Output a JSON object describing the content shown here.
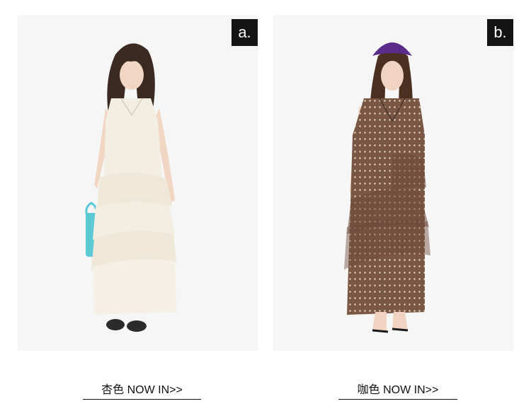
{
  "products": [
    {
      "badge": "a.",
      "link_text": "杏色 NOW IN>>",
      "image_alt": "apricot",
      "dress_color": "#f3eee2",
      "accent_color": "#5cc9d4"
    },
    {
      "badge": "b.",
      "link_text": "咖色 NOW IN>>",
      "image_alt": "coffee",
      "dress_color": "#7a5644",
      "accent_color": "#5b2b8a"
    }
  ]
}
